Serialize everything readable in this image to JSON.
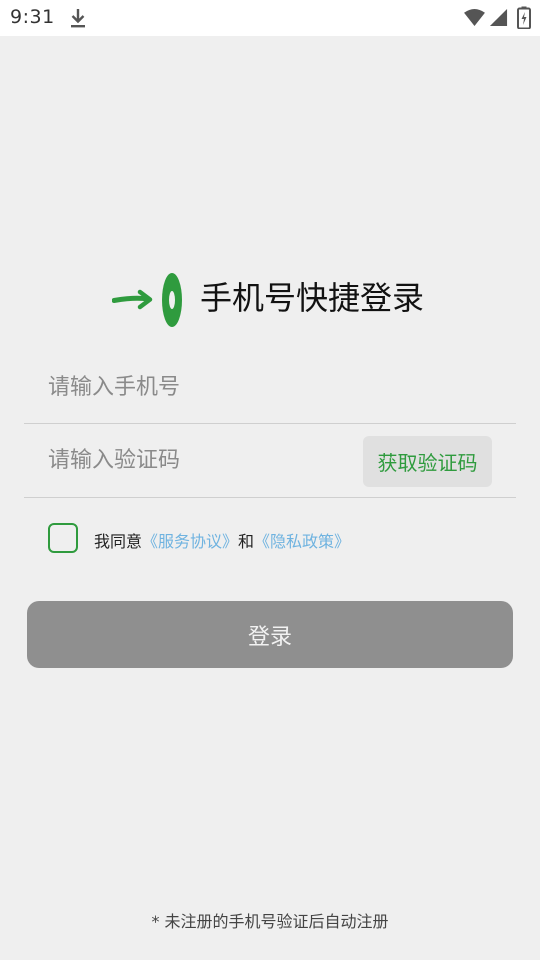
{
  "status_bar": {
    "time": "9:31",
    "icons": [
      "download-icon",
      "wifi-icon",
      "signal-icon",
      "battery-icon"
    ]
  },
  "logo": {
    "icon": "arrow-zero-logo-icon",
    "color": "#2f9b3e"
  },
  "title": "手机号快捷登录",
  "phone_field": {
    "placeholder": "请输入手机号",
    "value": ""
  },
  "code_field": {
    "placeholder": "请输入验证码",
    "value": ""
  },
  "get_code_button": {
    "label": "获取验证码"
  },
  "agreement": {
    "checked": false,
    "prefix": "我同意",
    "service_link": "《服务协议》",
    "connector": "和",
    "privacy_link": "《隐私政策》"
  },
  "login_button": {
    "label": "登录"
  },
  "footnote": "* 未注册的手机号验证后自动注册",
  "colors": {
    "accent": "#2f9b3e",
    "link": "#6fb3e0",
    "login_button_bg": "#8f8f8f",
    "background": "#efefef"
  }
}
